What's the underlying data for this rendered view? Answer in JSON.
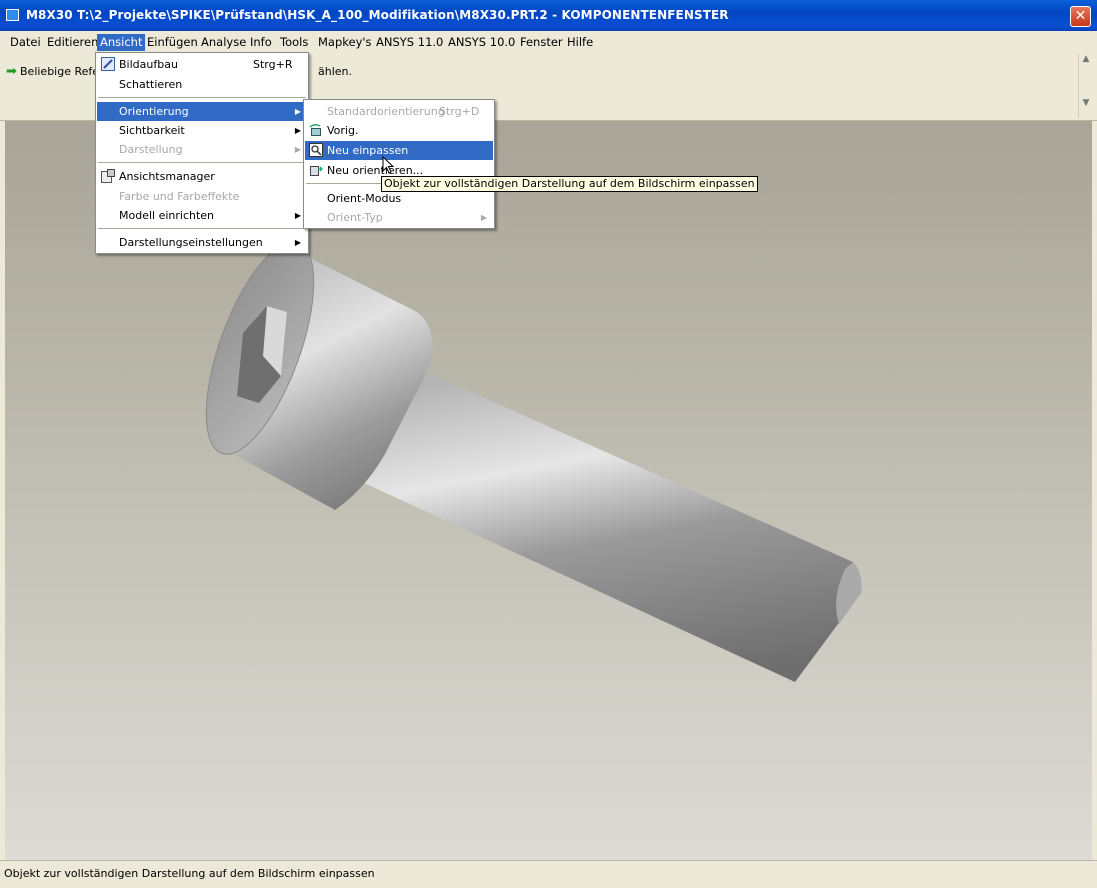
{
  "window": {
    "title": "M8X30 T:\\2_Projekte\\SPIKE\\Prüfstand\\HSK_A_100_Modifikation\\M8X30.PRT.2 - KOMPONENTENFENSTER",
    "close_glyph": "✕"
  },
  "menubar": [
    "Datei",
    "Editieren",
    "Ansicht",
    "Einfügen",
    "Analyse",
    "Info",
    "Tools",
    "Mapkey's",
    "ANSYS 11.0",
    "ANSYS 10.0",
    "Fenster",
    "Hilfe"
  ],
  "toolbar": {
    "hint_prefix": "Beliebige Refer",
    "hint_suffix": "ählen."
  },
  "ansicht_menu": {
    "items": [
      {
        "label": "Bildaufbau",
        "shortcut": "Strg+R",
        "icon": "repaint-icon"
      },
      {
        "label": "Schattieren"
      },
      {
        "label": "Orientierung",
        "submenu": true,
        "highlighted": true
      },
      {
        "label": "Sichtbarkeit",
        "submenu": true
      },
      {
        "label": "Darstellung",
        "submenu": true,
        "disabled": true
      },
      {
        "label": "Ansichtsmanager",
        "icon": "view-manager-icon"
      },
      {
        "label": "Farbe und Farbeffekte",
        "disabled": true
      },
      {
        "label": "Modell einrichten",
        "submenu": true
      },
      {
        "label": "Darstellungseinstellungen",
        "submenu": true
      }
    ]
  },
  "orientierung_menu": {
    "items": [
      {
        "label": "Standardorientierung",
        "shortcut": "Strg+D",
        "disabled": true
      },
      {
        "label": "Vorig.",
        "icon": "previous-view-icon"
      },
      {
        "label": "Neu einpassen",
        "icon": "refit-icon",
        "highlighted": true
      },
      {
        "label": "Neu orientieren...",
        "icon": "reorient-icon"
      },
      {
        "label": "Orient-Modus"
      },
      {
        "label": "Orient-Typ",
        "submenu": true,
        "disabled": true
      }
    ]
  },
  "tooltip": "Objekt zur vollständigen Darstellung auf dem Bildschirm einpassen",
  "statusbar": "Objekt zur vollständigen Darstellung auf dem Bildschirm einpassen",
  "model": {
    "name": "M8X30",
    "type": "socket-head-cap-screw"
  },
  "colors": {
    "titlebar": "#0a4fd0",
    "highlight": "#316ac5",
    "menu_bg": "#ece9d8",
    "tooltip_bg": "#ffffe1"
  }
}
